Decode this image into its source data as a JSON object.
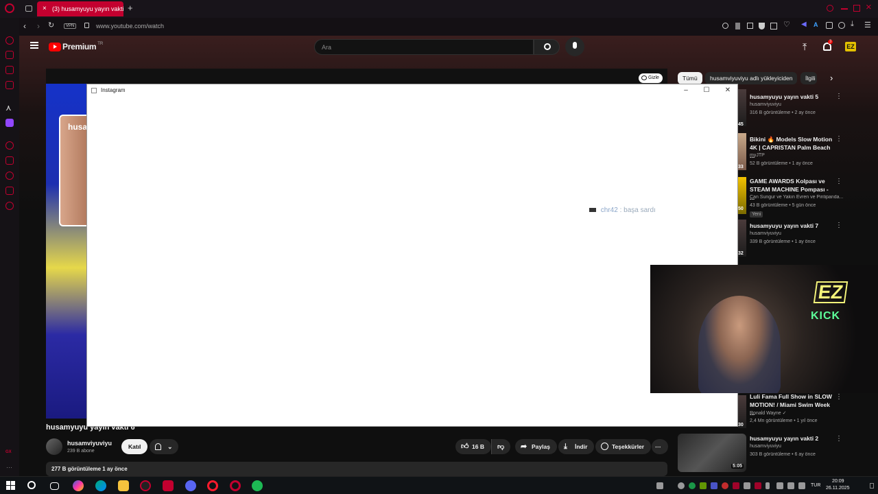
{
  "browser": {
    "active_tab": "(3) husamyuyu yayın vakti",
    "vpn_badge": "VPN",
    "url": "www.youtube.com/watch",
    "accent_color": "#c3002f"
  },
  "youtube": {
    "logo_text": "Premium",
    "logo_region": "TR",
    "search_placeholder": "Ara",
    "notification_count": "3",
    "hide_label": "Gizle",
    "video_title": "husamyuyu yayın vakti 6",
    "overlay_name_fragment": "husa",
    "channel_name": "husamviyuviyu",
    "subscribers": "239 B abone",
    "join_label": "Katıl",
    "like_count": "16 B",
    "share_label": "Paylaş",
    "download_label": "İndir",
    "thanks_label": "Teşekkürler",
    "description_meta": "277 B görüntüleme  1 ay önce",
    "filter_chips": [
      "Tümü",
      "husamviyuviyu adlı yükleyiciden",
      "İlgili"
    ],
    "recommendations": [
      {
        "title": "husamyuyu yayın vakti 5",
        "channel": "husamviyuviyu",
        "meta": "316 B görüntüleme • 2 ay önce",
        "duration": "45"
      },
      {
        "title": "Bikini 🔥 Models Slow Motion 4K | CAPRISTAN Palm Beach ...",
        "channel": "myJTP",
        "meta": "52 B görüntüleme • 1 ay önce",
        "duration": "33"
      },
      {
        "title": "GAME AWARDS Kolpası ve STEAM MACHINE Pompası - ...",
        "channel": "Can Sungur ve Yakın Evren ve Pintipanda...",
        "meta": "43 B görüntüleme • 5 gün önce",
        "badge": "Yeni",
        "duration": "50"
      },
      {
        "title": "husamyuyu yayın vakti 7",
        "channel": "husamviyuviyu",
        "meta": "339 B görüntüleme • 1 ay önce",
        "duration": "32"
      },
      {
        "title": "Luli Fama Full Show in SLOW MOTION! / Miami Swim Week ...",
        "channel": "Ronald Wayne ✓",
        "meta": "2,4 Mn görüntüleme • 1 yıl önce",
        "duration": "30"
      },
      {
        "title": "husamyuyu yayın vakti 2",
        "channel": "husamviyuviyu",
        "meta": "303 B görüntüleme • 6 ay önce",
        "duration": "5:05"
      }
    ]
  },
  "popup": {
    "title": "Instagram",
    "chat_user": "chr42",
    "chat_text": ": başa sardı"
  },
  "webcam": {
    "logo": "EZ",
    "kick_text": "KICK"
  },
  "taskbar": {
    "language": "TUR",
    "time": "20:09",
    "date": "26.11.2025"
  },
  "sidebar_footer": "GX"
}
